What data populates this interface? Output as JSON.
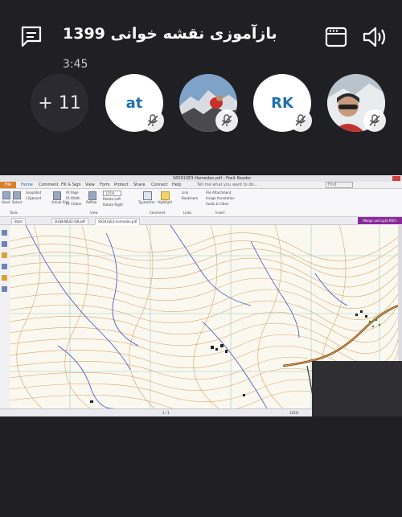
{
  "header": {
    "title": "بازآموزی نقشه خوانی 1399",
    "timer": "3:45",
    "icons": {
      "chat": "chat-icon",
      "layout": "layout-icon",
      "speaker": "speaker-icon"
    }
  },
  "participants": {
    "more_label": "+ 11",
    "items": [
      {
        "type": "initials",
        "label": "at",
        "muted": true
      },
      {
        "type": "photo",
        "label": "",
        "muted": true
      },
      {
        "type": "initials",
        "label": "RK",
        "muted": true
      },
      {
        "type": "photo",
        "label": "",
        "muted": true
      }
    ]
  },
  "shared_screen": {
    "window_title": "S6591SE3-Hamedan.pdf - Foxit Reader",
    "menu": [
      "File",
      "Home",
      "Comment",
      "Fill & Sign",
      "View",
      "Form",
      "Protect",
      "Share",
      "Connect",
      "Help"
    ],
    "tell_me": "Tell me what you want to do...",
    "find_placeholder": "Find",
    "ribbon": {
      "hand": "Hand",
      "select": "Select",
      "snapshot": "SnapShot",
      "clipboard": "Clipboard",
      "actual_size": "Actual Size",
      "fit_page": "Fit Page",
      "fit_width": "Fit Width",
      "fit_visible": "Fit Visible",
      "reflow": "Reflow",
      "zoom": "125%",
      "rotate_left": "Rotate Left",
      "rotate_right": "Rotate Right",
      "typewriter": "Typewriter",
      "highlight": "Highlight",
      "link": "Link",
      "bookmark": "Bookmark",
      "file_attachment": "File Attachment",
      "image_annotation": "Image Annotation",
      "audio_video": "Audio & Video",
      "groups": [
        "Tools",
        "View",
        "Comment",
        "Links",
        "Insert"
      ]
    },
    "merge_button": "Merge and split PDFs",
    "doc_tabs": [
      "Start",
      "D338-NE42-Q8.pdf",
      "S6591SE3-hamedan.pdf"
    ],
    "status_page": "1 / 1",
    "status_zoom": "125%"
  }
}
